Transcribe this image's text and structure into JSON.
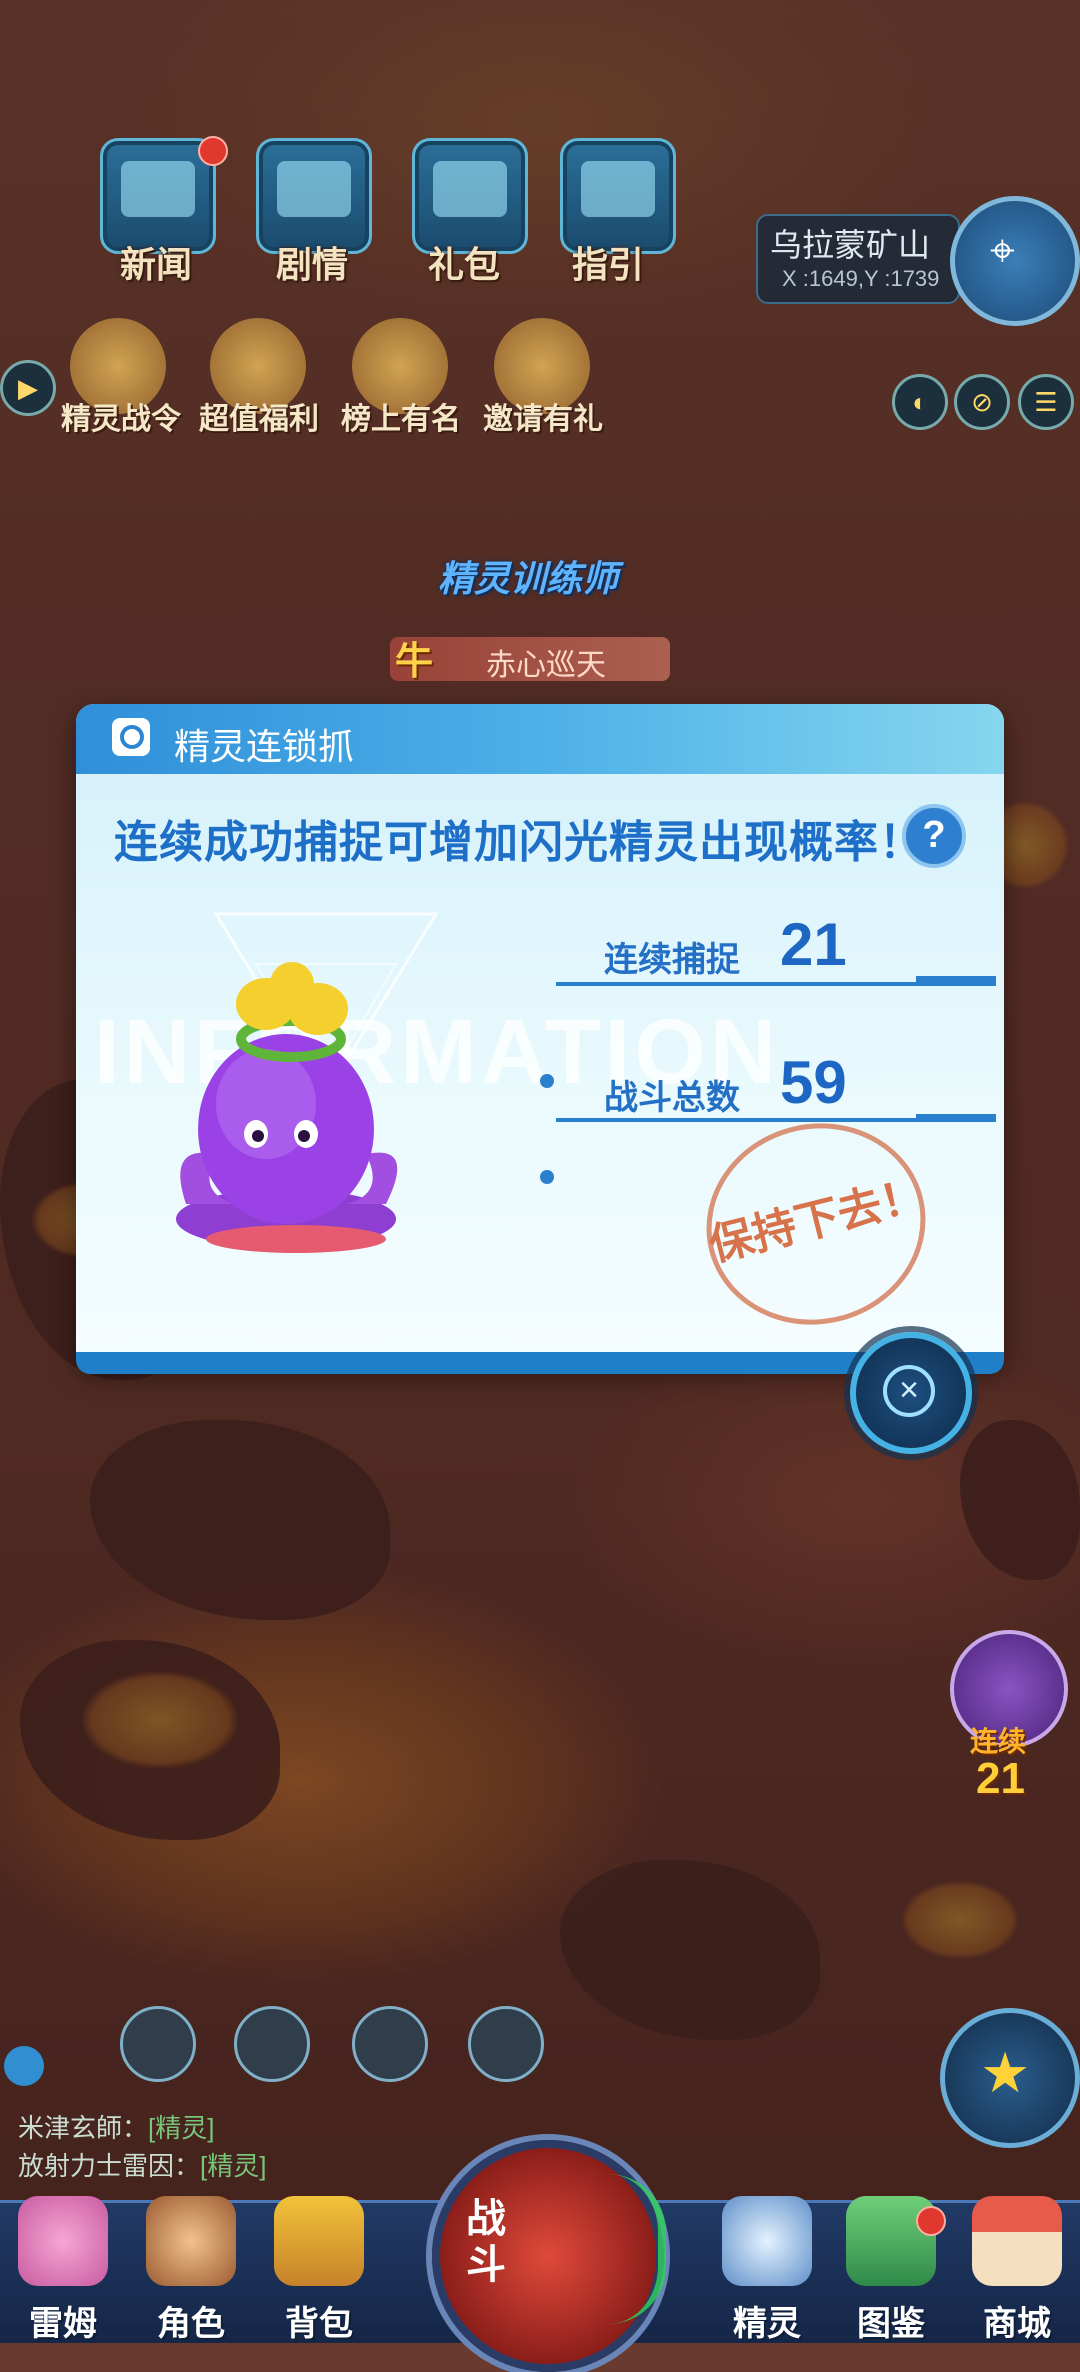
{
  "top_menu": [
    {
      "label": "新闻",
      "icon": "news-board-icon",
      "badge": true
    },
    {
      "label": "剧情",
      "icon": "story-screen-icon",
      "badge": false
    },
    {
      "label": "礼包",
      "icon": "gift-pack-icon",
      "badge": false
    },
    {
      "label": "指引",
      "icon": "guide-terminal-icon",
      "badge": false
    }
  ],
  "location": {
    "name": "乌拉蒙矿山",
    "coords": "X :1649,Y :1739"
  },
  "activities": [
    {
      "label": "精灵战令"
    },
    {
      "label": "超值福利"
    },
    {
      "label": "榜上有名"
    },
    {
      "label": "邀请有礼"
    }
  ],
  "player": {
    "title": "精灵训练师",
    "badge": "牛",
    "name": "赤心巡天"
  },
  "modal": {
    "title": "精灵连锁抓",
    "headline": "连续成功捕捉可增加闪光精灵出现概率！",
    "help": "?",
    "watermark": "INFORMATION",
    "stats": [
      {
        "label": "连续捕捉",
        "value": "21"
      },
      {
        "label": "战斗总数",
        "value": "59"
      }
    ],
    "stamp": "保持下去！",
    "close": "×"
  },
  "streak": {
    "label": "连续",
    "value": "21"
  },
  "chat": [
    {
      "sender": "米津玄師：",
      "content": "[精灵]"
    },
    {
      "sender": "放射力士雷因：",
      "content": "[精灵]"
    }
  ],
  "dock": [
    {
      "label": "雷姆"
    },
    {
      "label": "角色"
    },
    {
      "label": "背包"
    },
    {
      "label": "精灵"
    },
    {
      "label": "图鉴"
    },
    {
      "label": "商城"
    }
  ],
  "battle": {
    "label": "战斗"
  },
  "colors": {
    "accent": "#2a7fcf",
    "header_gradient_start": "#2f8fd9",
    "stamp": "#d8724b",
    "dock": "#213a66"
  }
}
